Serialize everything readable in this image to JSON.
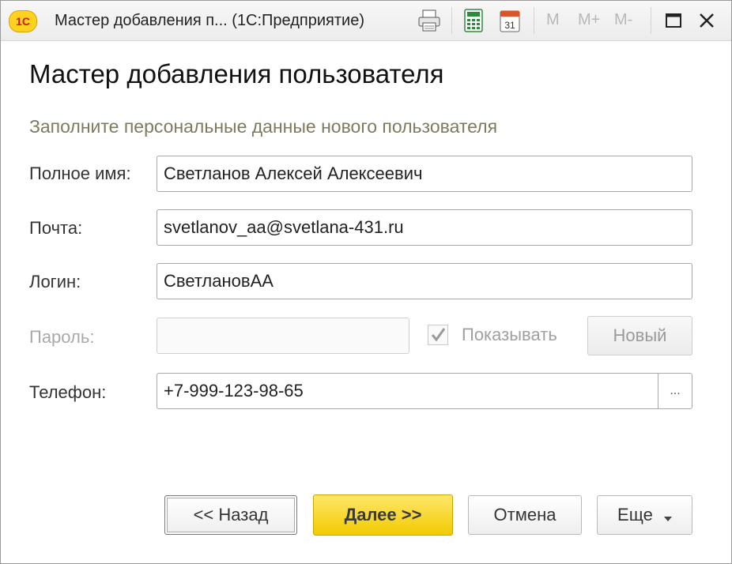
{
  "window": {
    "logo": "1С",
    "title": "Мастер добавления п... (1С:Предприятие)",
    "memory_buttons": [
      "M",
      "M+",
      "M-"
    ],
    "calendar_day": "31",
    "icons": [
      "print-icon",
      "calculator-icon",
      "calendar-icon",
      "maximize-icon",
      "close-icon"
    ]
  },
  "form": {
    "heading": "Мастер добавления пользователя",
    "subtitle": "Заполните персональные данные нового пользователя",
    "fields": {
      "full_name": {
        "label": "Полное имя:",
        "value": "Светланов Алексей Алексеевич"
      },
      "email": {
        "label": "Почта:",
        "value": "svetlanov_aa@svetlana-431.ru"
      },
      "login": {
        "label": "Логин:",
        "value": "СветлановАА"
      },
      "password": {
        "label": "Пароль:",
        "value": ""
      },
      "phone": {
        "label": "Телефон:",
        "value": "+7-999-123-98-65",
        "select_label": "..."
      }
    },
    "show_password": {
      "label": "Показывать",
      "checked": true
    },
    "new_password_button": "Новый"
  },
  "footer": {
    "back": "<< Назад",
    "next": "Далее >>",
    "cancel": "Отмена",
    "more": "Еще"
  },
  "colors": {
    "primary_button": "#f2cb00",
    "subtitle": "#7d7a5e",
    "disabled_text": "#a9a9a9"
  }
}
